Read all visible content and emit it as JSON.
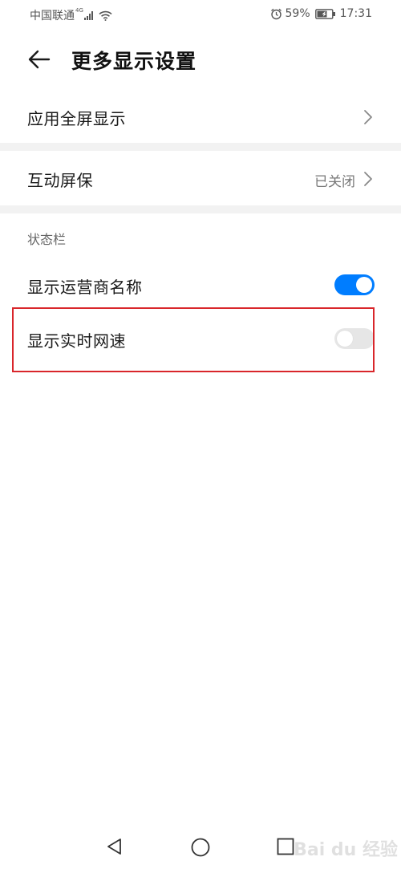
{
  "status_bar": {
    "carrier": "中国联通",
    "network_tag": "4G",
    "battery_percent": "59%",
    "time": "17:31",
    "icons": [
      "signal-icon",
      "wifi-icon",
      "alarm-icon",
      "battery-charging-icon"
    ]
  },
  "header": {
    "title": "更多显示设置",
    "back_icon": "back-arrow-icon"
  },
  "settings": {
    "fullscreen_apps": {
      "label": "应用全屏显示"
    },
    "screensaver": {
      "label": "互动屏保",
      "value": "已关闭"
    },
    "status_bar_section": {
      "title": "状态栏",
      "carrier_name": {
        "label": "显示运营商名称",
        "enabled": true
      },
      "network_speed": {
        "label": "显示实时网速",
        "enabled": false
      }
    }
  },
  "nav_bar": {
    "icons": [
      "nav-back-icon",
      "nav-home-icon",
      "nav-recent-icon"
    ]
  },
  "watermark": "Bai du 经验",
  "colors": {
    "toggle_on": "#007dff",
    "toggle_off": "#e6e6e6",
    "highlight": "#d9262b",
    "divider": "#f2f2f2"
  }
}
